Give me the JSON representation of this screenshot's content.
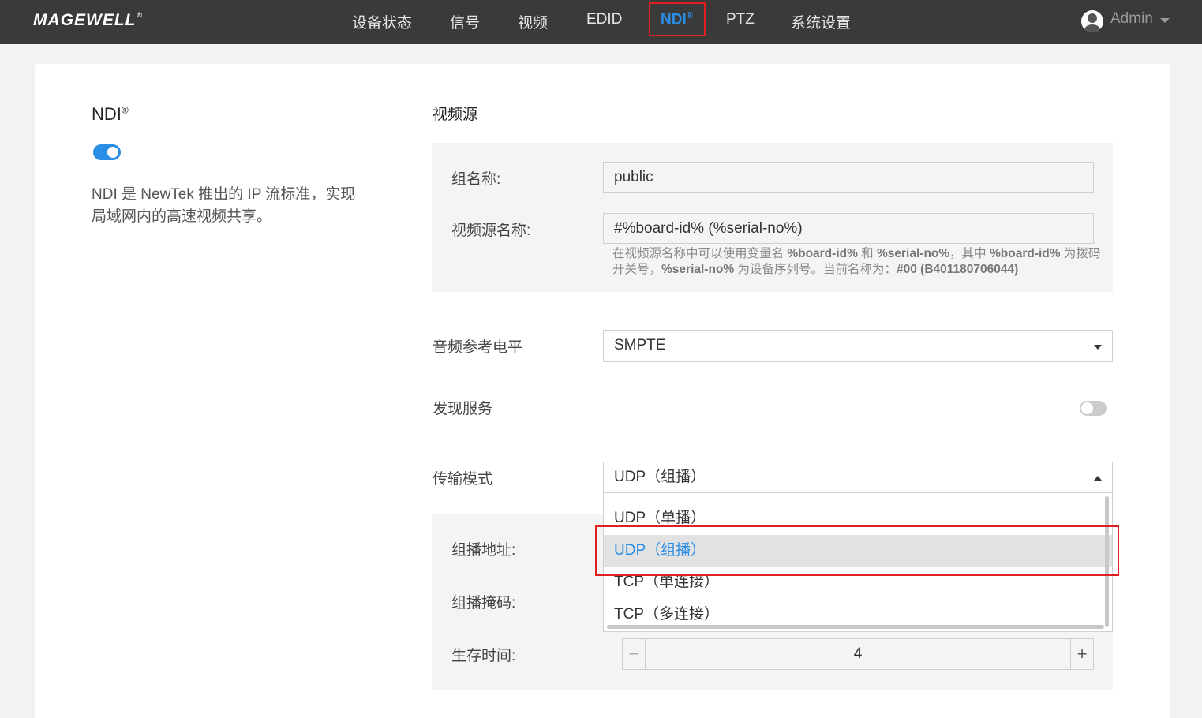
{
  "header": {
    "logo": "MAGEWELL",
    "logo_mark": "®",
    "nav": [
      {
        "label": "设备状态"
      },
      {
        "label": "信号"
      },
      {
        "label": "视频"
      },
      {
        "label": "EDID"
      },
      {
        "label": "NDI",
        "sup": "®",
        "active": true
      },
      {
        "label": "PTZ"
      },
      {
        "label": "系统设置"
      }
    ],
    "user": {
      "name": "Admin",
      "icon": "user-avatar-icon"
    }
  },
  "left_panel": {
    "title": "NDI",
    "title_mark": "®",
    "toggle_on": true,
    "description": "NDI 是 NewTek 推出的 IP 流标准，实现局域网内的高速视频共享。"
  },
  "video_source": {
    "section_title": "视频源",
    "group_name_label": "组名称:",
    "group_name_value": "public",
    "source_name_label": "视频源名称:",
    "source_name_value": "#%board-id% (%serial-no%)",
    "hint": {
      "p1": "在视频源名称中可以使用变量名 ",
      "v1": "%board-id%",
      "p2": " 和 ",
      "v2": "%serial-no%",
      "p3": "，其中 ",
      "v3": "%board-id%",
      "p4": " 为拨码开关号，",
      "v4": "%serial-no%",
      "p5": " 为设备序列号。当前名称为：",
      "v5": "#00 (B401180706044)"
    }
  },
  "audio_ref": {
    "label": "音频参考电平",
    "value": "SMPTE"
  },
  "discovery": {
    "label": "发现服务",
    "toggle_on": false
  },
  "transport": {
    "label": "传输模式",
    "value": "UDP（组播）",
    "options": [
      "UDP（单播）",
      "UDP（组播）",
      "TCP（单连接）",
      "TCP（多连接）"
    ],
    "selected_index": 1
  },
  "multicast": {
    "address_label": "组播地址:",
    "mask_label": "组播掩码:",
    "ttl_label": "生存时间:",
    "ttl_value": "4",
    "minus": "−",
    "plus": "+"
  },
  "colors": {
    "accent": "#2a8de6",
    "highlight_border": "#e02020",
    "topbar": "#3a3a3a"
  }
}
